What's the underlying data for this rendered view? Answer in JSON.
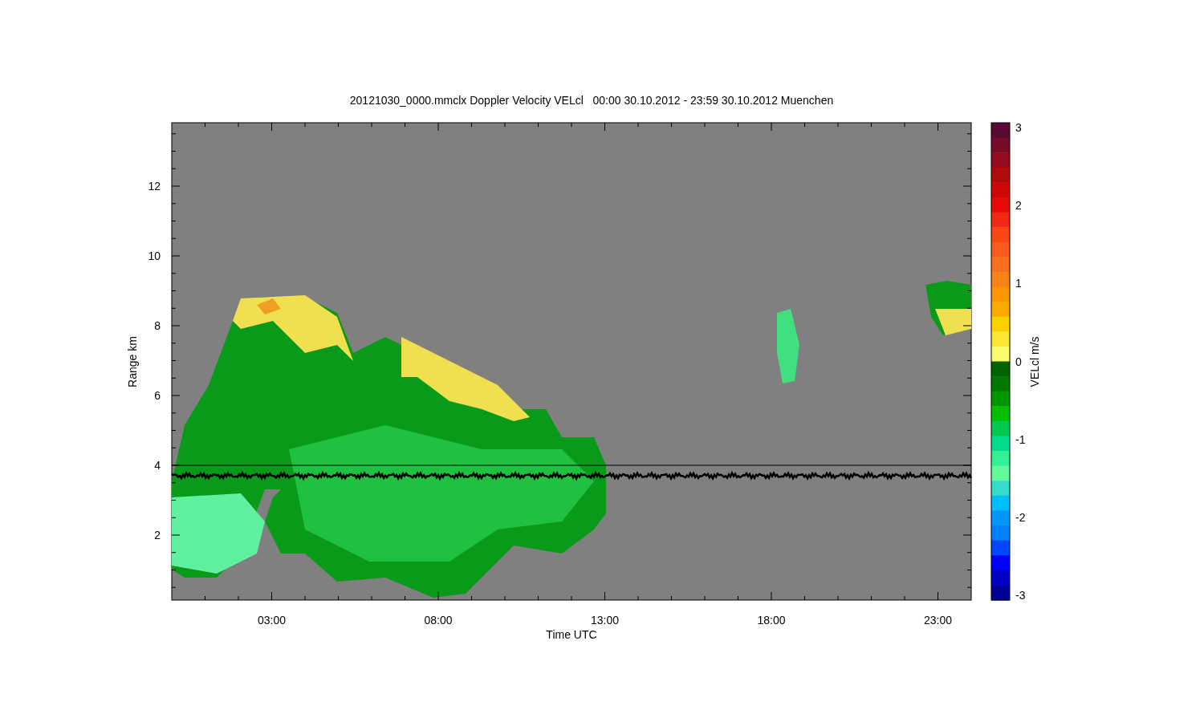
{
  "title": "20121030_0000.mmclx Doppler Velocity VELcl   00:00 30.10.2012 - 23:59 30.10.2012 Muenchen",
  "plot": {
    "xlabel": "Time UTC",
    "ylabel": "Range km",
    "xticks": [
      "03:00",
      "08:00",
      "13:00",
      "18:00",
      "23:00"
    ],
    "yticks": [
      "12",
      "10",
      "8",
      "6",
      "4",
      "2"
    ]
  },
  "colorbar": {
    "label": "VELcl m/s",
    "ticks": [
      "3",
      "2",
      "1",
      "0",
      "-1",
      "-2",
      "-3"
    ],
    "bands": [
      {
        "color": "#5a0a32"
      },
      {
        "color": "#780a2a"
      },
      {
        "color": "#940a1e"
      },
      {
        "color": "#b00a0a"
      },
      {
        "color": "#cc0808"
      },
      {
        "color": "#e60a0a"
      },
      {
        "color": "#f02814"
      },
      {
        "color": "#fa4614"
      },
      {
        "color": "#fa5a1e"
      },
      {
        "color": "#fa6e1e"
      },
      {
        "color": "#fa8214"
      },
      {
        "color": "#fa9600"
      },
      {
        "color": "#faaa00"
      },
      {
        "color": "#fad200"
      },
      {
        "color": "#fae632"
      },
      {
        "color": "#fafa6e"
      },
      {
        "color": "#006400"
      },
      {
        "color": "#007800"
      },
      {
        "color": "#009600"
      },
      {
        "color": "#00be00"
      },
      {
        "color": "#00c850"
      },
      {
        "color": "#00dc8c"
      },
      {
        "color": "#32f096"
      },
      {
        "color": "#64fa9b"
      },
      {
        "color": "#32dcc8"
      },
      {
        "color": "#00beff"
      },
      {
        "color": "#0096ff"
      },
      {
        "color": "#0082ff"
      },
      {
        "color": "#0046fa"
      },
      {
        "color": "#0000fa"
      },
      {
        "color": "#0000c8"
      },
      {
        "color": "#000096"
      }
    ]
  }
}
